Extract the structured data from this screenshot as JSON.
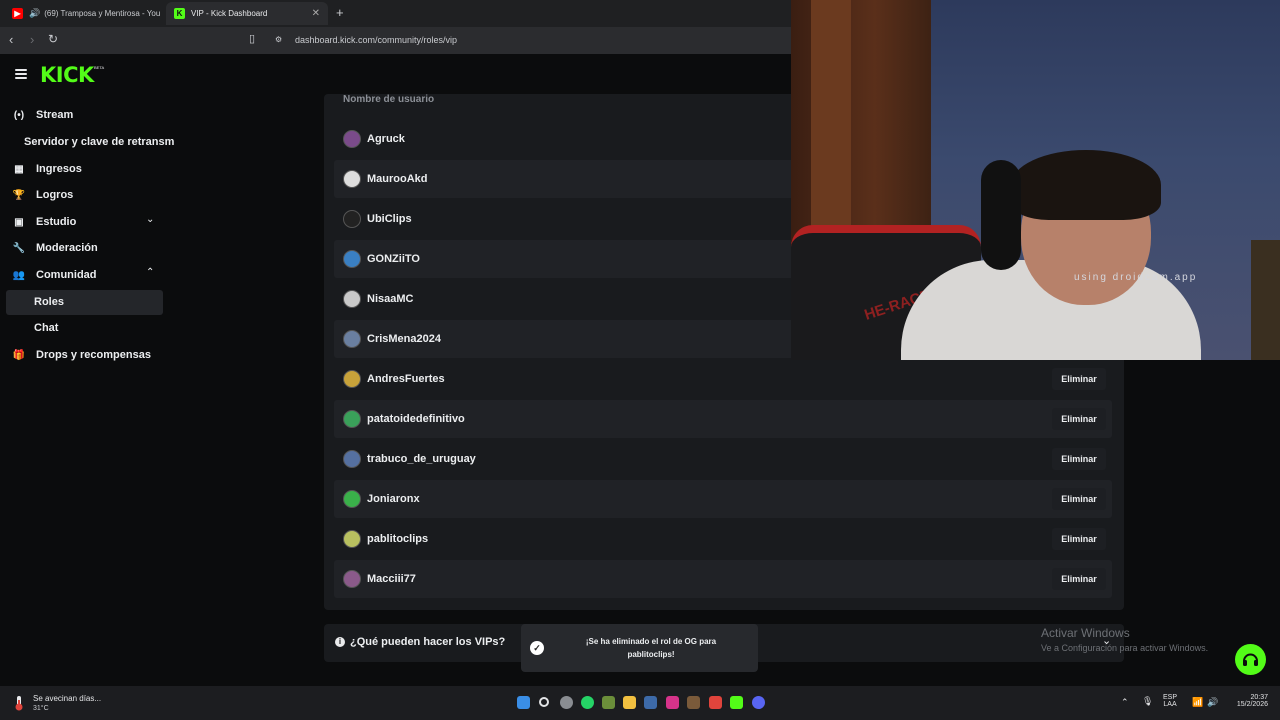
{
  "browser": {
    "tabs": [
      {
        "title": "(69) Tramposa y Mentirosa - You",
        "active": false
      },
      {
        "title": "VIP - Kick Dashboard",
        "active": true
      }
    ],
    "url": "dashboard.kick.com/community/roles/vip"
  },
  "app": {
    "logo": "KICK",
    "logo_badge": "BETA",
    "brand_color": "#53fc18"
  },
  "sidebar": {
    "stream": "Stream",
    "stream_key": "Servidor y clave de retransm",
    "ingresos": "Ingresos",
    "logros": "Logros",
    "estudio": "Estudio",
    "moderacion": "Moderación",
    "comunidad": "Comunidad",
    "roles": "Roles",
    "chat": "Chat",
    "drops": "Drops y recompensas"
  },
  "table": {
    "header": "Nombre de usuario",
    "remove_label": "Eliminar",
    "rows": [
      "Agruck",
      "MaurooAkd",
      "UbiClips",
      "GONZiiTO",
      "NisaaMC",
      "CrisMena2024",
      "AndresFuertes",
      "patatoidedefinitivo",
      "trabuco_de_uruguay",
      "Joniaronx",
      "pablitoclips",
      "Macciii77"
    ]
  },
  "faq": {
    "label": "¿Qué pueden hacer los VIPs?"
  },
  "toast": {
    "line1": "¡Se ha eliminado el rol de OG para",
    "line2": "pablitoclips!"
  },
  "watermark": {
    "activate_title": "Activar Windows",
    "activate_sub": "Ve a Configuración para activar Windows."
  },
  "webcam": {
    "overlay_text": "using droidcam.app",
    "chair_text": "HE-RACER"
  },
  "taskbar": {
    "weather_title": "Se avecinan días...",
    "weather_temp": "31°C",
    "lang_top": "ESP",
    "lang_bottom": "LAA",
    "time": "20:37",
    "date": "15/2/2026"
  }
}
